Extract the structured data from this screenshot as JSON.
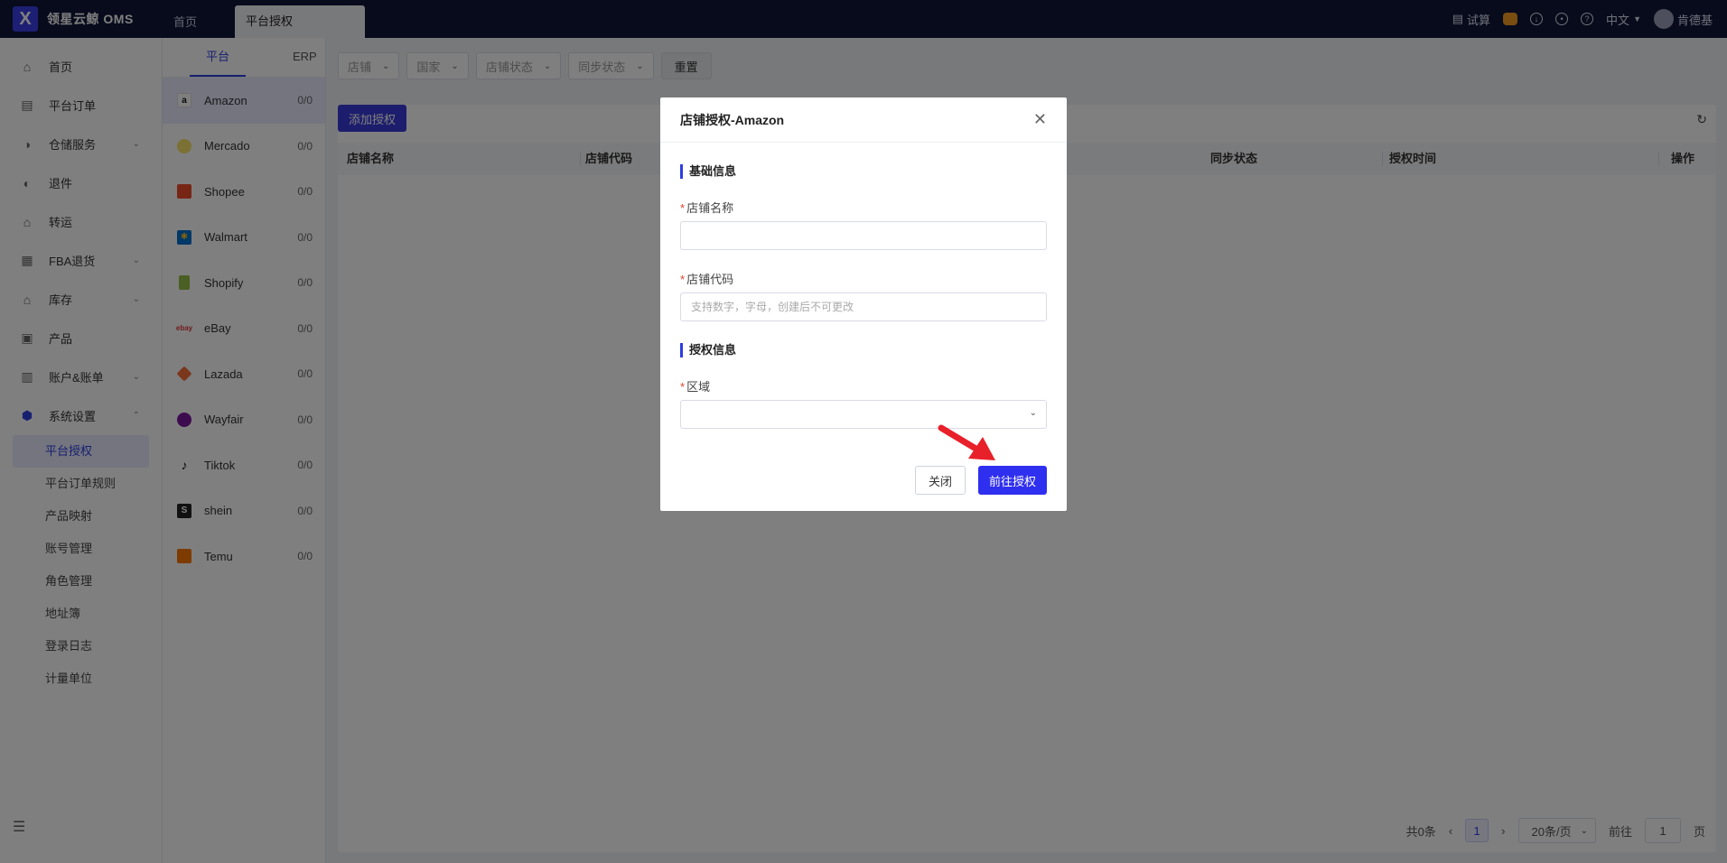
{
  "app": {
    "logo_text": "领星云鲸 OMS",
    "logo_glyph": "X"
  },
  "top_tabs": [
    {
      "label": "首页"
    },
    {
      "label": "平台授权"
    }
  ],
  "top_right": {
    "calc": "试算",
    "language": "中文",
    "user": "肯德基"
  },
  "sidebar": {
    "items": [
      {
        "label": "首页",
        "icon": "home-icon"
      },
      {
        "label": "平台订单",
        "icon": "order-icon"
      },
      {
        "label": "仓储服务",
        "icon": "warehouse-icon"
      },
      {
        "label": "退件",
        "icon": "return-icon"
      },
      {
        "label": "转运",
        "icon": "transfer-icon"
      },
      {
        "label": "FBA退货",
        "icon": "fba-icon"
      },
      {
        "label": "库存",
        "icon": "inventory-icon"
      },
      {
        "label": "产品",
        "icon": "product-icon"
      },
      {
        "label": "账户&账单",
        "icon": "account-icon"
      },
      {
        "label": "系统设置",
        "icon": "settings-icon"
      }
    ],
    "sub_items": [
      {
        "label": "平台授权"
      },
      {
        "label": "平台订单规则"
      },
      {
        "label": "产品映射"
      },
      {
        "label": "账号管理"
      },
      {
        "label": "角色管理"
      },
      {
        "label": "地址簿"
      },
      {
        "label": "登录日志"
      },
      {
        "label": "计量单位"
      }
    ]
  },
  "platform_tabs": [
    {
      "label": "平台"
    },
    {
      "label": "ERP"
    }
  ],
  "platforms": [
    {
      "name": "Amazon",
      "count": "0/0",
      "color": "#ffffff",
      "glyph": "a"
    },
    {
      "name": "Mercado",
      "count": "0/0",
      "color": "#f7e36a",
      "glyph": ""
    },
    {
      "name": "Shopee",
      "count": "0/0",
      "color": "#ee4d2d",
      "glyph": ""
    },
    {
      "name": "Walmart",
      "count": "0/0",
      "color": "#0071ce",
      "glyph": "✱"
    },
    {
      "name": "Shopify",
      "count": "0/0",
      "color": "#95bf47",
      "glyph": ""
    },
    {
      "name": "eBay",
      "count": "0/0",
      "color": "#ffffff",
      "glyph": ""
    },
    {
      "name": "Lazada",
      "count": "0/0",
      "color": "#f36f36",
      "glyph": ""
    },
    {
      "name": "Wayfair",
      "count": "0/0",
      "color": "#7b189f",
      "glyph": ""
    },
    {
      "name": "Tiktok",
      "count": "0/0",
      "color": "#ffffff",
      "glyph": "♪"
    },
    {
      "name": "shein",
      "count": "0/0",
      "color": "#222222",
      "glyph": "S"
    },
    {
      "name": "Temu",
      "count": "0/0",
      "color": "#fb7701",
      "glyph": ""
    }
  ],
  "filters": [
    {
      "label": "店铺"
    },
    {
      "label": "国家"
    },
    {
      "label": "店铺状态"
    },
    {
      "label": "同步状态"
    }
  ],
  "reset_label": "重置",
  "add_button": "添加授权",
  "table": {
    "columns": [
      {
        "label": "店铺名称"
      },
      {
        "label": "店铺代码"
      },
      {
        "label": "同步状态"
      },
      {
        "label": "授权时间"
      },
      {
        "label": "操作"
      }
    ]
  },
  "pagination": {
    "total": "共0条",
    "current": "1",
    "page_size": "20条/页",
    "goto_label": "前往",
    "goto_value": "1",
    "page_suffix": "页"
  },
  "modal": {
    "title": "店铺授权-Amazon",
    "section_basic": "基础信息",
    "store_name_label": "店铺名称",
    "store_name_value": "",
    "store_code_label": "店铺代码",
    "store_code_placeholder": "支持数字，字母，创建后不可更改",
    "section_auth": "授权信息",
    "region_label": "区域",
    "close_button": "关闭",
    "auth_button": "前往授权"
  },
  "colors": {
    "accent": "#2f3ee0",
    "topbar": "#0f1639",
    "arrow": "#e8202a"
  }
}
